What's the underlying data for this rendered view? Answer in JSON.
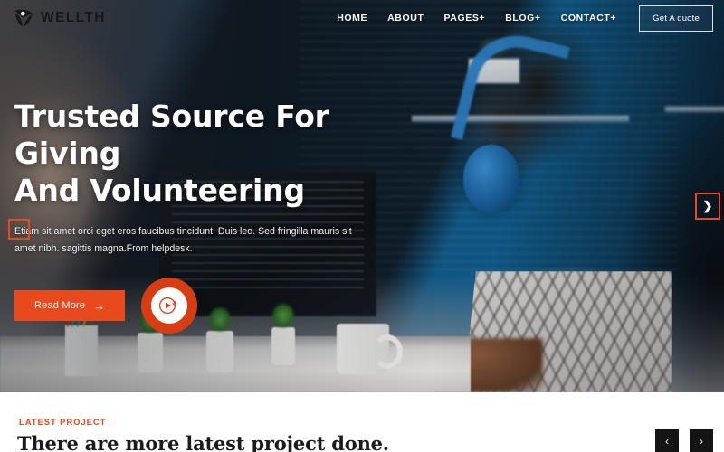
{
  "header": {
    "logo_text": "WELLTH",
    "logo_icon": "leaf-triangle-logo-icon",
    "nav": [
      {
        "label": "HOME"
      },
      {
        "label": "ABOUT"
      },
      {
        "label": "PAGES+"
      },
      {
        "label": "BLOG+"
      },
      {
        "label": "CONTACT+"
      }
    ],
    "quote_button": "Get A quote"
  },
  "hero": {
    "title_line1": "Trusted Source For Giving",
    "title_line2": "And Volunteering",
    "description": "Etiam sit amet orci eget eros faucibus tincidunt. Duis leo. Sed fringilla mauris sit amet nibh. sagittis magna.From helpdesk.",
    "read_more": "Read More",
    "read_more_arrow": "→",
    "play_icon": "play-circle-icon",
    "slider_next_icon": "chevron-right-icon",
    "slider_next_glyph": "❯"
  },
  "projects": {
    "eyebrow": "LATEST PROJECT",
    "title": "There are more latest project done.",
    "prev_glyph": "‹",
    "next_glyph": "›",
    "prev_icon": "chevron-left-icon",
    "next_icon": "chevron-right-icon"
  },
  "colors": {
    "accent": "#e8491d",
    "play_button": "#d83c13",
    "section_title": "#1b1b1b",
    "nav_text": "#ffffff",
    "arrow_button_bg": "#141414"
  }
}
